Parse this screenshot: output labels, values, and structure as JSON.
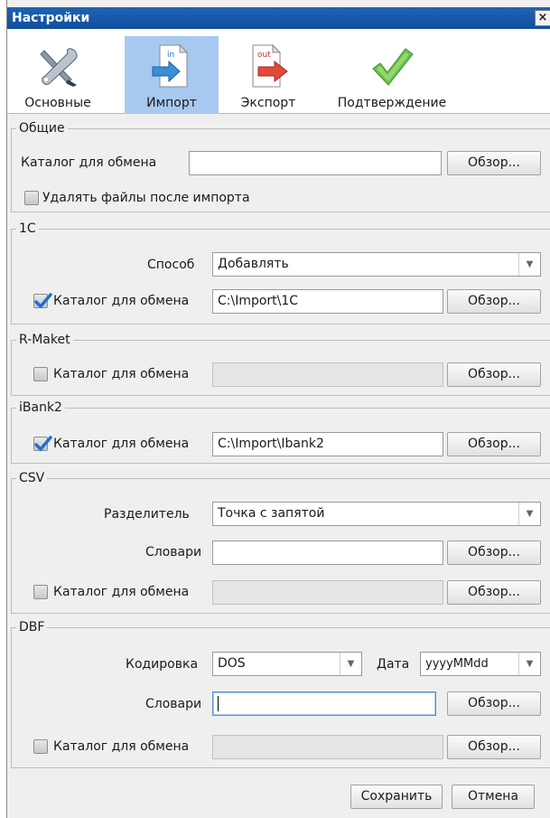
{
  "window": {
    "title": "Настройки",
    "close_glyph": "×"
  },
  "tabs": [
    {
      "label": "Основные",
      "icon": "wrench-screwdriver-icon",
      "active": false
    },
    {
      "label": "Импорт",
      "icon": "import-in-icon",
      "active": true
    },
    {
      "label": "Экспорт",
      "icon": "export-out-icon",
      "active": false
    },
    {
      "label": "Подтверждение",
      "icon": "checkmark-icon",
      "active": false
    }
  ],
  "common_labels": {
    "exchange_dir": "Каталог для обмена",
    "browse": "Обзор...",
    "dictionaries": "Словари"
  },
  "general": {
    "title": "Общие",
    "exchange_dir_value": "",
    "delete_files_label": "Удалять файлы после импорта",
    "delete_files_checked": false
  },
  "onec": {
    "title": "1С",
    "method_label": "Способ",
    "method_value": "Добавлять",
    "exchange_dir_checked": true,
    "exchange_dir_value": "C:\\Import\\1C"
  },
  "rmaket": {
    "title": "R-Maket",
    "exchange_dir_checked": false,
    "exchange_dir_value": ""
  },
  "ibank2": {
    "title": "iBank2",
    "exchange_dir_checked": true,
    "exchange_dir_value": "C:\\Import\\Ibank2"
  },
  "csv": {
    "title": "CSV",
    "separator_label": "Разделитель",
    "separator_value": "Точка с запятой",
    "dictionaries_value": "",
    "exchange_dir_checked": false,
    "exchange_dir_value": ""
  },
  "dbf": {
    "title": "DBF",
    "encoding_label": "Кодировка",
    "encoding_value": "DOS",
    "date_label": "Дата",
    "date_value": "yyyyMMdd",
    "dictionaries_value": "",
    "exchange_dir_checked": false,
    "exchange_dir_value": ""
  },
  "footer": {
    "save_label": "Сохранить",
    "cancel_label": "Отмена"
  },
  "colors": {
    "title_bar": "#1a5aa8",
    "active_tab": "#a7c9f0",
    "check_blue": "#1e6fd0"
  }
}
